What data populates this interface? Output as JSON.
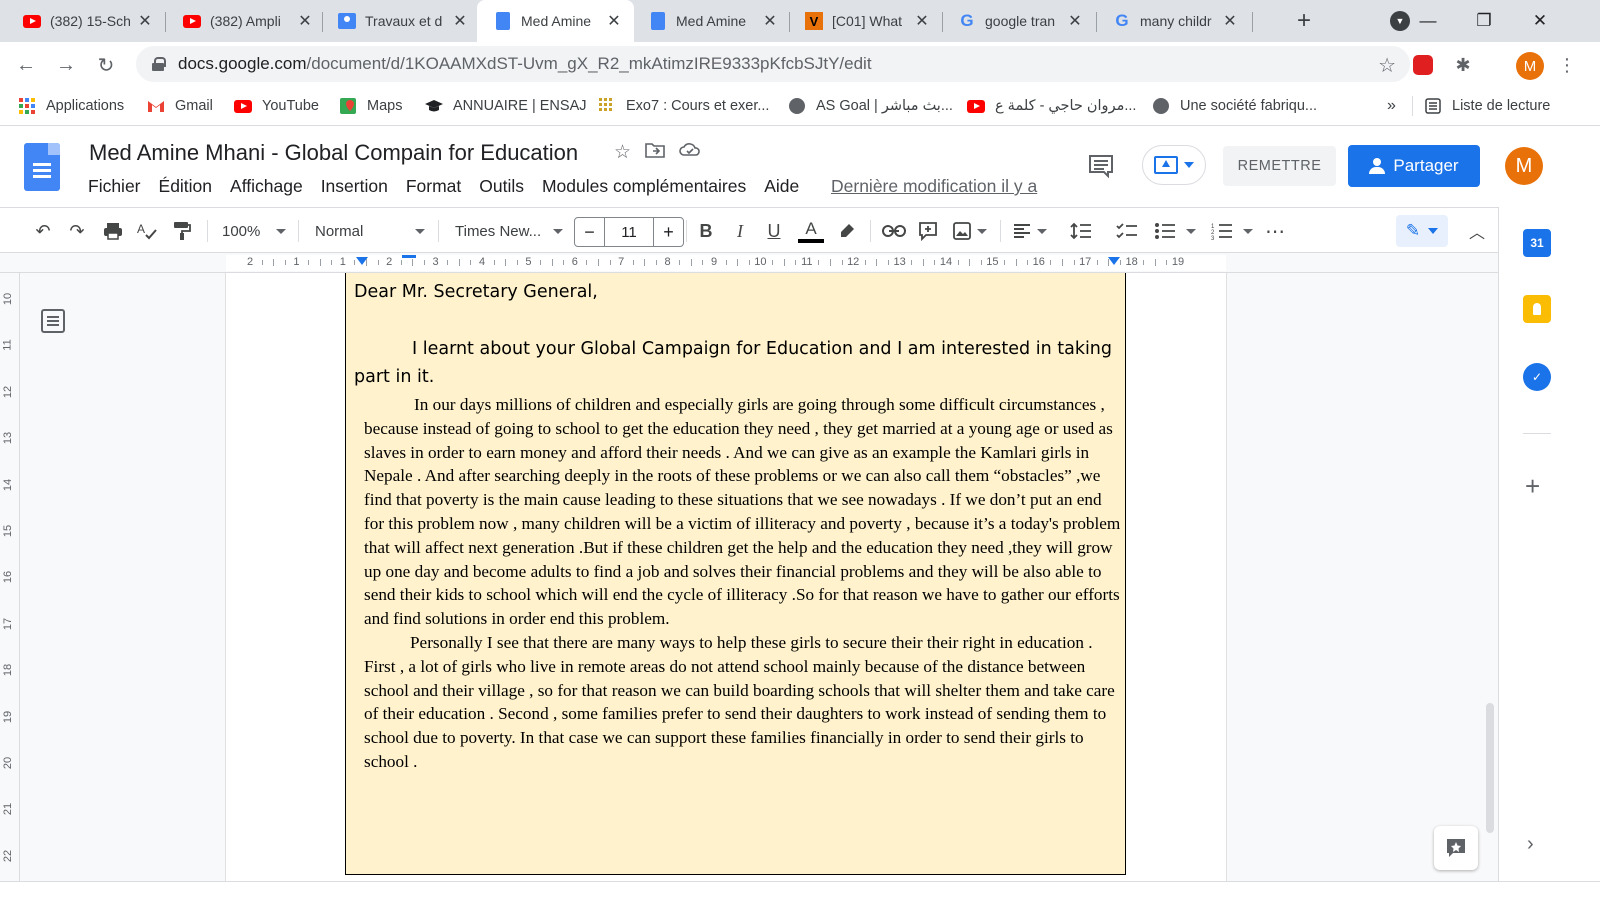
{
  "browser": {
    "tabs": [
      {
        "title": "(382) 15-Sch",
        "icon": "youtube-icon",
        "active": false
      },
      {
        "title": "(382) Ampli",
        "icon": "youtube-icon",
        "active": false
      },
      {
        "title": "Travaux et d",
        "icon": "classroom-icon",
        "active": false
      },
      {
        "title": "Med Amine",
        "icon": "docs-icon",
        "active": true
      },
      {
        "title": "Med Amine",
        "icon": "docs-icon",
        "active": false
      },
      {
        "title": "[C01] What",
        "icon": "v-icon",
        "active": false
      },
      {
        "title": "google tran",
        "icon": "google-icon",
        "active": false
      },
      {
        "title": "many childr",
        "icon": "google-icon",
        "active": false
      }
    ],
    "url_host": "docs.google.com",
    "url_path": "/document/d/1KOAAMXdST-Uvm_gX_R2_mkAtimzIRE9333pKfcbSJtY/edit",
    "profile_initial": "M",
    "bookmarks": [
      {
        "label": "Applications",
        "icon": "apps-grid-icon"
      },
      {
        "label": "Gmail",
        "icon": "gmail-icon"
      },
      {
        "label": "YouTube",
        "icon": "youtube-icon"
      },
      {
        "label": "Maps",
        "icon": "maps-icon"
      },
      {
        "label": "ANNUAIRE | ENSAJ",
        "icon": "graduation-cap-icon"
      },
      {
        "label": "Exo7 : Cours et exer...",
        "icon": "exo7-icon"
      },
      {
        "label": "AS Goal | بث مباشر...",
        "icon": "asgoal-icon"
      },
      {
        "label": "مروان حاجي - كلمة ع...",
        "icon": "youtube-icon"
      },
      {
        "label": "Une société fabriqu...",
        "icon": "globe-icon"
      }
    ],
    "bookmarks_more": "»",
    "reading_list": "Liste de lecture"
  },
  "docs": {
    "title": "Med Amine Mhani - Global Compain for Education",
    "menu": [
      "Fichier",
      "Édition",
      "Affichage",
      "Insertion",
      "Format",
      "Outils",
      "Modules complémentaires",
      "Aide"
    ],
    "last_edit": "Dernière modification il y a",
    "remettre": "REMETTRE",
    "share": "Partager",
    "avatar_initial": "M"
  },
  "toolbar": {
    "zoom": "100%",
    "style": "Normal",
    "font": "Times New...",
    "font_size": "11"
  },
  "ruler": {
    "labels": [
      "2",
      "1",
      "1",
      "2",
      "3",
      "4",
      "5",
      "6",
      "7",
      "8",
      "9",
      "10",
      "11",
      "12",
      "13",
      "14",
      "15",
      "16",
      "17",
      "18",
      "19"
    ]
  },
  "vruler": {
    "labels": [
      "10",
      "11",
      "12",
      "13",
      "14",
      "15",
      "16",
      "17",
      "18",
      "19",
      "20",
      "21",
      "22"
    ]
  },
  "document": {
    "greeting": "Dear Mr. Secretary General,",
    "intro_line1": "I learnt about your Global Campaign for Education and I am interested in taking",
    "intro_line2": "part in it.",
    "paragraph1": "In our days millions of children and especially girls are going through some difficult circumstances , because instead of going to school to get the education they need , they get married at a young age or used as slaves in order to earn money and afford their needs . And we can give as an example the Kamlari girls in Nepale . And after searching deeply in the roots of these problems or we can also call them “obstacles” ,we find that poverty is the main cause leading to these situations that we see nowadays . If we don’t put an end for this problem now , many children will be a victim of illiteracy and poverty , because it’s a today's problem that will affect next generation .But if these children get the help and the education they need ,they will grow up one day and become adults to find a job and solves their financial problems and they will be also able to send their kids to school which will end the cycle of illiteracy .So for that reason we have to gather our efforts and find solutions in order end this problem.",
    "paragraph2": "Personally I see that there are many ways to help these girls to secure their their  right in education . First , a lot of girls who live in remote areas do not attend school mainly because of the distance between school and their village , so for that reason we can build boarding schools that will shelter them and take care of their education . Second , some families prefer to send their daughters to work instead of sending them to school due to poverty. In that case we can support these families financially in order to send their girls to school ."
  },
  "colors": {
    "accent": "#1a73e8",
    "textbox_fill": "#fff2cc",
    "avatar": "#e8710a"
  }
}
